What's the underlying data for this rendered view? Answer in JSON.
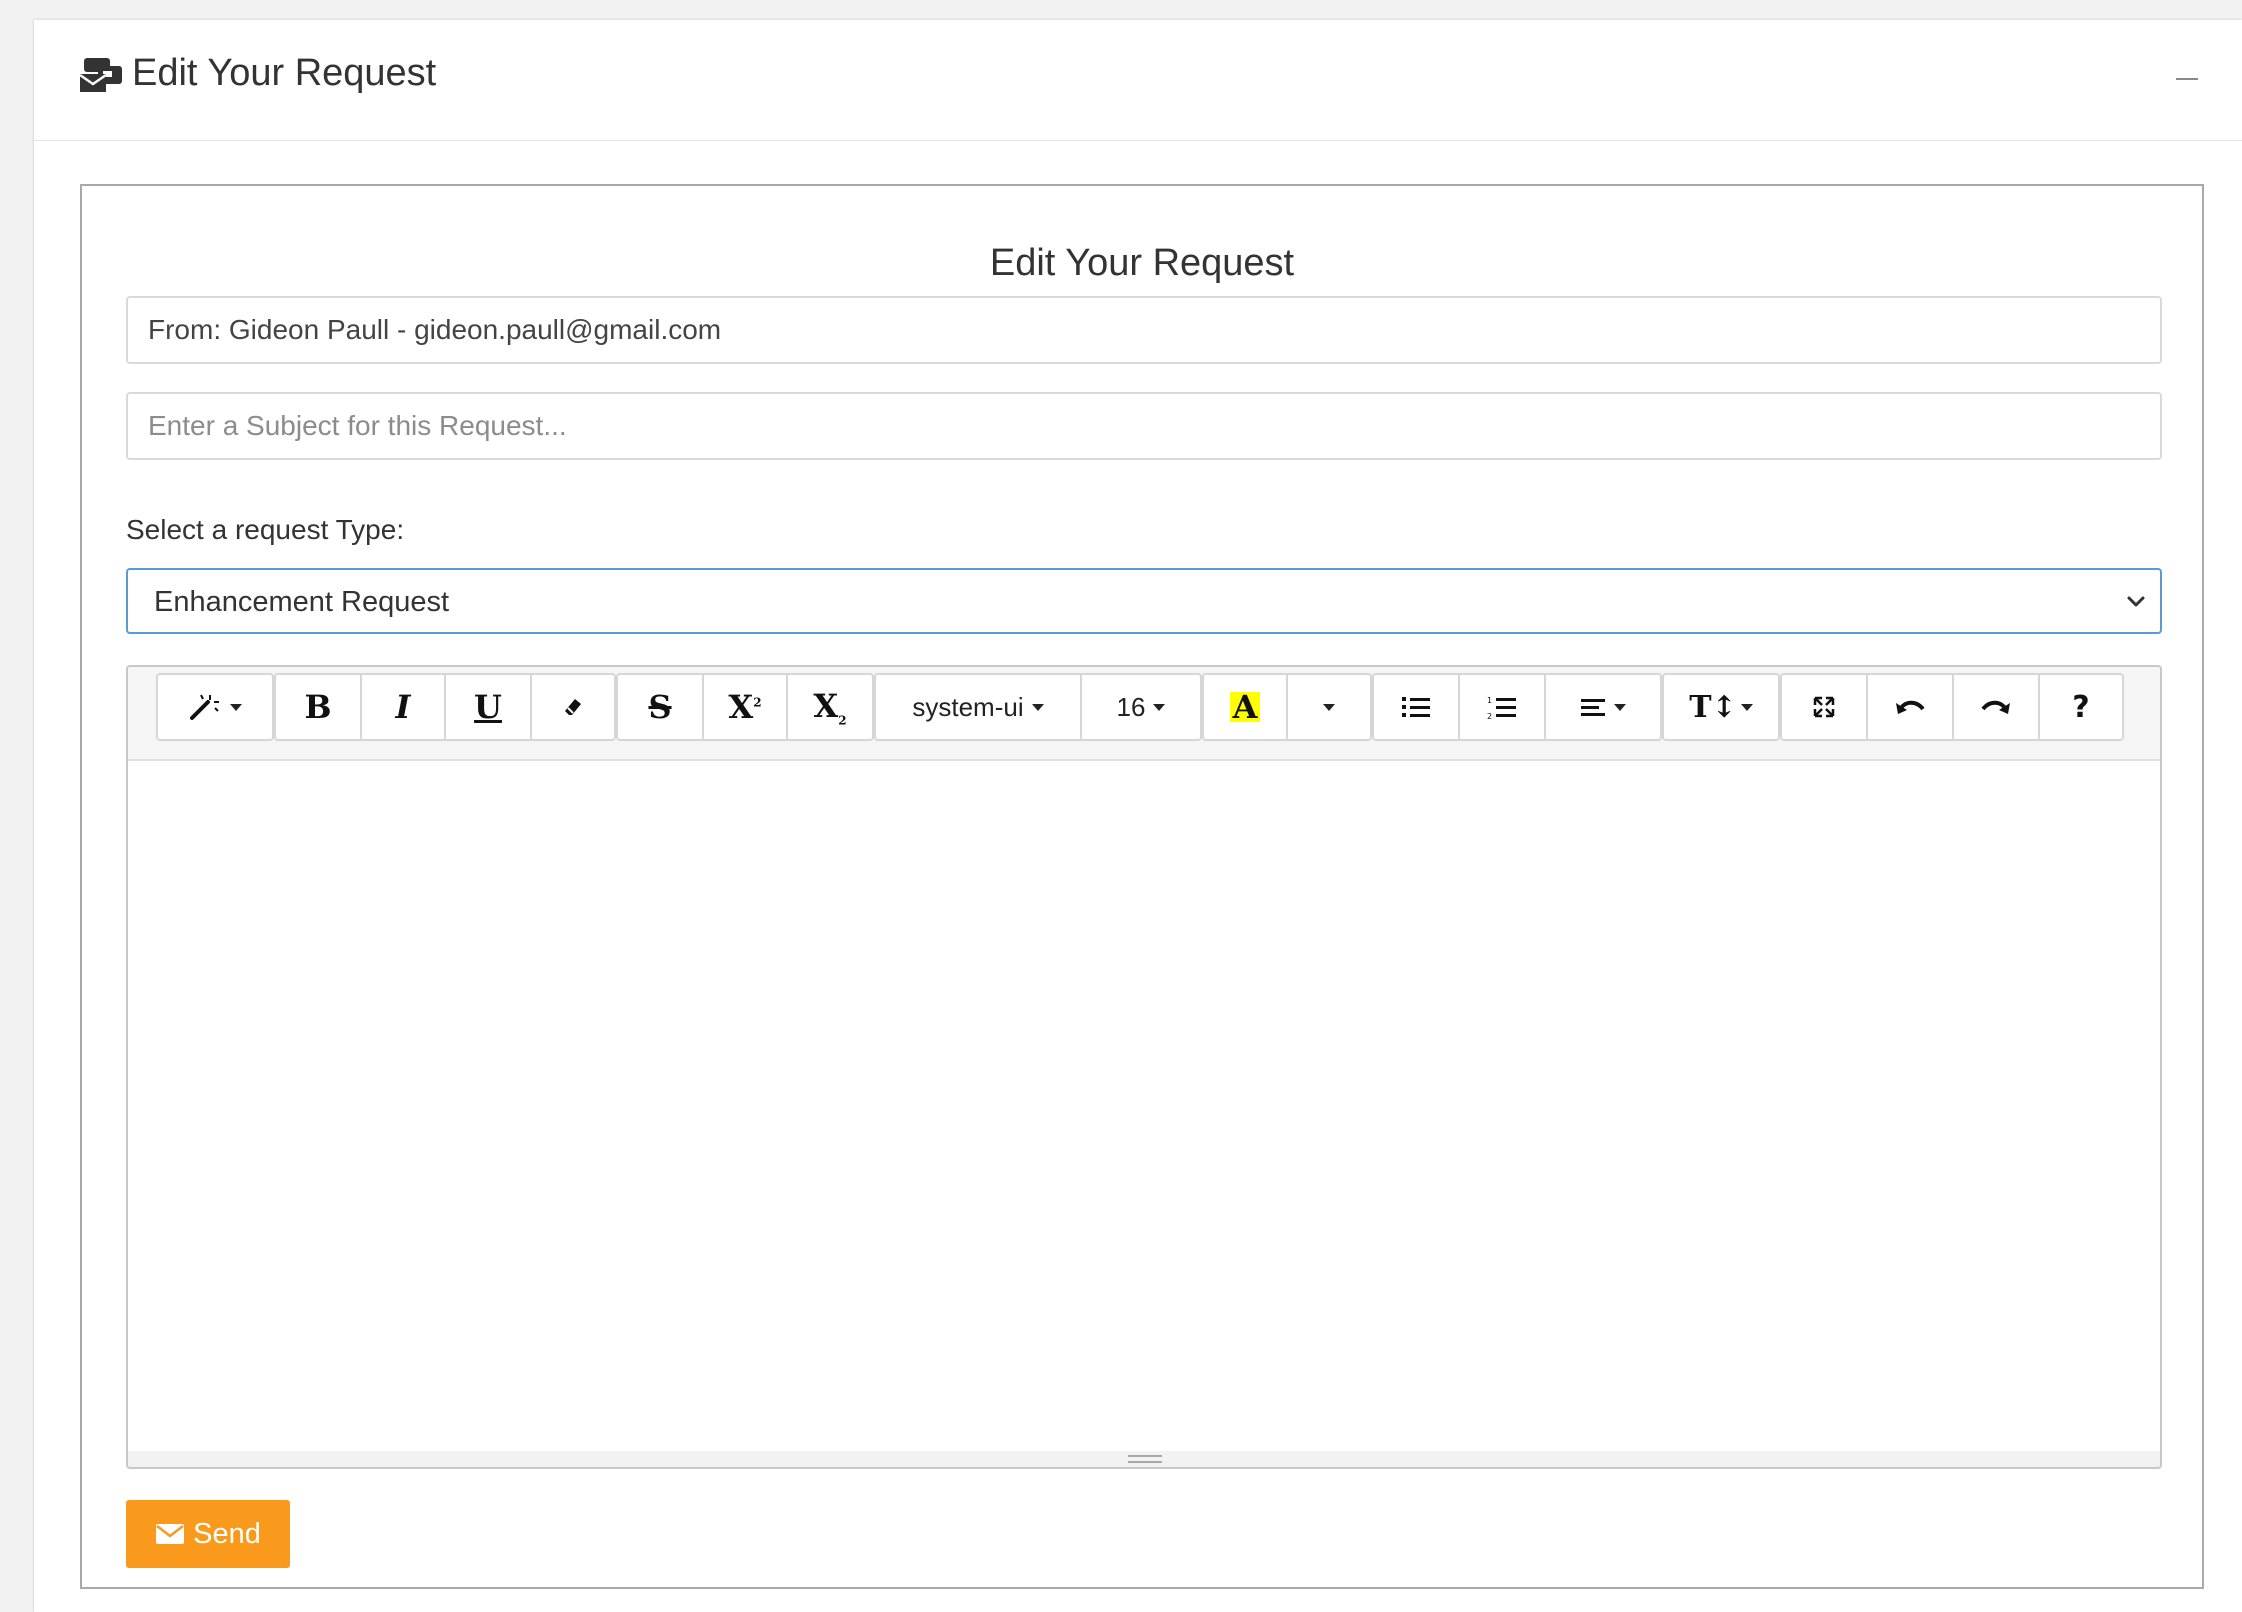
{
  "header": {
    "title": "Edit Your Request",
    "icon": "mailbox-icon"
  },
  "form": {
    "title": "Edit Your Request",
    "from_value": "From: Gideon Paull - gideon.paull@gmail.com",
    "subject_placeholder": "Enter a Subject for this Request...",
    "subject_value": "",
    "type_label": "Select a request Type:",
    "type_selected": "Enhancement Request",
    "send_label": "Send"
  },
  "toolbar": {
    "font_family": "system-ui",
    "font_size": "16",
    "highlight_letter": "A",
    "bold": "B",
    "italic": "I",
    "underline": "U",
    "strike": "S",
    "superscript": "X",
    "subscript": "X",
    "help": "?"
  },
  "colors": {
    "accent": "#f99a1c",
    "select_border": "#5b9bd5",
    "highlight": "#ffff00"
  }
}
